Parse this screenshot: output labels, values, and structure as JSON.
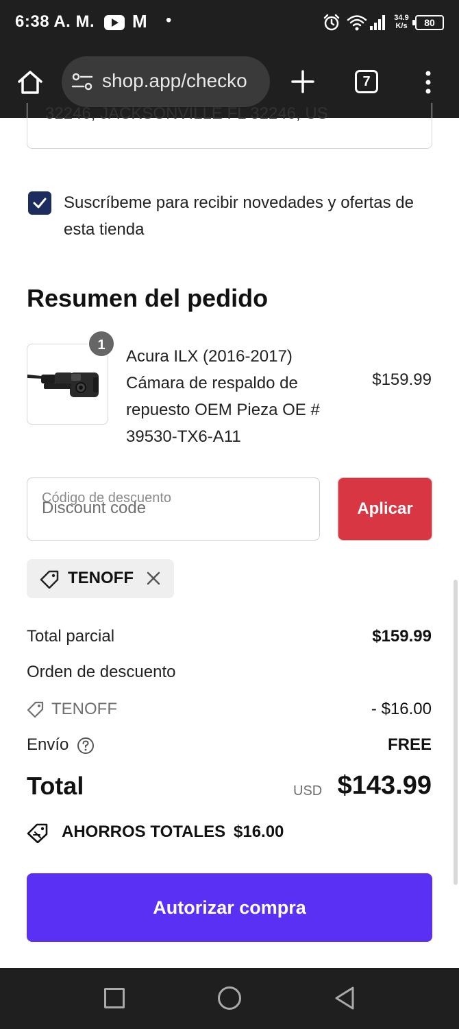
{
  "status_bar": {
    "time": "6:38 A. M.",
    "gmail_glyph": "M",
    "dot": "•",
    "net_speed_value": "34.9",
    "net_speed_unit": "K/s",
    "battery": "80"
  },
  "browser": {
    "url": "shop.app/checko",
    "tab_count": "7",
    "icons": [
      "home-icon",
      "tune-icon",
      "plus-icon",
      "tabs-icon",
      "more-vert-icon"
    ]
  },
  "address": {
    "partial_text": "32246, JACKSONVILLE FL 32246, US"
  },
  "subscribe": {
    "checked": true,
    "label": "Suscríbeme para recibir novedades y ofertas de esta tienda"
  },
  "summary": {
    "title": "Resumen del pedido",
    "item": {
      "quantity": "1",
      "name": "Acura ILX (2016-2017) Cámara de respaldo de repuesto OEM Pieza OE # 39530-TX6-A11",
      "price": "$159.99"
    },
    "discount": {
      "label": "Código de descuento",
      "placeholder": "Discount code",
      "apply_label": "Aplicar",
      "applied_code": "TENOFF"
    },
    "rows": {
      "subtotal_label": "Total parcial",
      "subtotal_value": "$159.99",
      "order_discount_label": "Orden de descuento",
      "discount_code": "TENOFF",
      "discount_value": "- $16.00",
      "shipping_label": "Envío",
      "shipping_value": "FREE"
    },
    "total": {
      "label": "Total",
      "currency": "USD",
      "value": "$143.99"
    },
    "savings": {
      "label": "AHORROS TOTALES",
      "value": "$16.00"
    },
    "checkout_label": "Autorizar compra"
  },
  "colors": {
    "checkout_button": "#5a31f4",
    "apply_button": "#d93644",
    "checkbox": "#1d2c5e",
    "system_bar": "#1f1f1f"
  }
}
